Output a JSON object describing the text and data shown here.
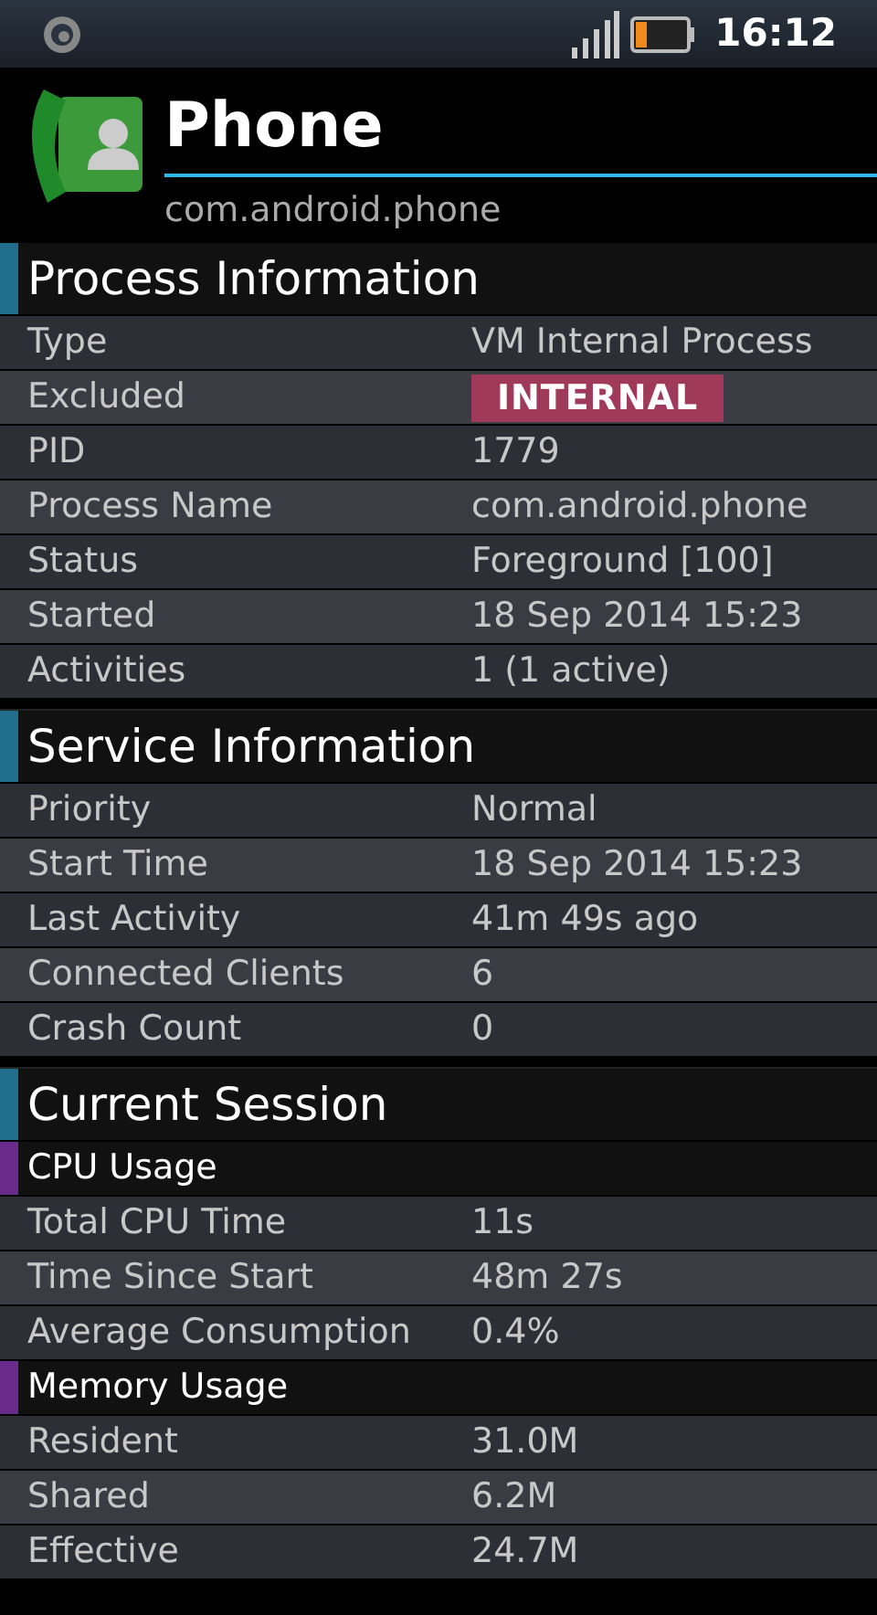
{
  "status_bar": {
    "time": "16:12"
  },
  "header": {
    "title": "Phone",
    "package": "com.android.phone"
  },
  "sections": [
    {
      "kind": "main",
      "title": "Process Information",
      "rows": [
        {
          "label": "Type",
          "value": "VM Internal Process",
          "kind": "text"
        },
        {
          "label": "Excluded",
          "value": "INTERNAL",
          "kind": "badge"
        },
        {
          "label": "PID",
          "value": "1779",
          "kind": "text"
        },
        {
          "label": "Process Name",
          "value": "com.android.phone",
          "kind": "text"
        },
        {
          "label": "Status",
          "value": "Foreground [100]",
          "kind": "text"
        },
        {
          "label": "Started",
          "value": "18 Sep 2014 15:23",
          "kind": "text"
        },
        {
          "label": "Activities",
          "value": "1 (1 active)",
          "kind": "text"
        }
      ]
    },
    {
      "kind": "main",
      "title": "Service Information",
      "rows": [
        {
          "label": "Priority",
          "value": "Normal",
          "kind": "text"
        },
        {
          "label": "Start Time",
          "value": "18 Sep 2014 15:23",
          "kind": "text"
        },
        {
          "label": "Last Activity",
          "value": "41m 49s ago",
          "kind": "text"
        },
        {
          "label": "Connected Clients",
          "value": "6",
          "kind": "text"
        },
        {
          "label": "Crash Count",
          "value": "0",
          "kind": "text"
        }
      ]
    },
    {
      "kind": "main",
      "title": "Current Session"
    },
    {
      "kind": "sub",
      "title": "CPU Usage",
      "rows": [
        {
          "label": "Total CPU Time",
          "value": "11s",
          "kind": "text"
        },
        {
          "label": "Time Since Start",
          "value": "48m 27s",
          "kind": "text"
        },
        {
          "label": "Average Consumption",
          "value": "0.4%",
          "kind": "text"
        }
      ]
    },
    {
      "kind": "sub",
      "title": "Memory Usage",
      "rows": [
        {
          "label": "Resident",
          "value": "31.0M",
          "kind": "text"
        },
        {
          "label": "Shared",
          "value": "6.2M",
          "kind": "text"
        },
        {
          "label": "Effective",
          "value": "24.7M",
          "kind": "text"
        }
      ]
    }
  ]
}
